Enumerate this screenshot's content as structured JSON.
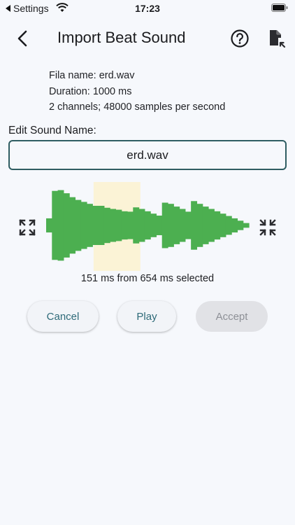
{
  "status_bar": {
    "back_label": "Settings",
    "time": "17:23"
  },
  "app_bar": {
    "title": "Import Beat Sound",
    "back_icon": "arrow-back-icon",
    "help_icon": "help-circle-icon",
    "file_icon": "file-import-icon"
  },
  "file_info": {
    "name_line": "Fila name: erd.wav",
    "duration_line": "Duration: 1000 ms",
    "format_line": "2 channels; 48000 samples per second"
  },
  "edit": {
    "label": "Edit Sound Name:",
    "value": "erd.wav"
  },
  "waveform": {
    "selection_text": "151 ms from 654 ms selected",
    "total_ms": 654,
    "selection_start_ms": 153,
    "selection_length_ms": 151,
    "amplitudes": [
      0.18,
      0.88,
      0.9,
      0.82,
      0.72,
      0.65,
      0.6,
      0.55,
      0.5,
      0.5,
      0.45,
      0.42,
      0.4,
      0.36,
      0.35,
      0.46,
      0.42,
      0.36,
      0.3,
      0.25,
      0.58,
      0.55,
      0.48,
      0.42,
      0.35,
      0.62,
      0.55,
      0.48,
      0.42,
      0.36,
      0.3,
      0.24,
      0.18,
      0.12,
      0.06
    ],
    "wave_color": "#4caf50",
    "selection_color": "#fbf3d6"
  },
  "buttons": {
    "cancel": "Cancel",
    "play": "Play",
    "accept": "Accept"
  }
}
